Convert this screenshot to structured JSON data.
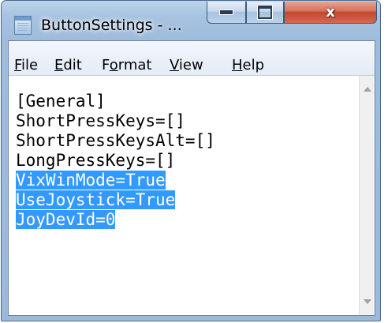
{
  "window": {
    "title": "ButtonSettings - ...",
    "close_glyph": "x",
    "icon": "notepad-icon"
  },
  "menubar": {
    "items": [
      {
        "underline": "F",
        "rest": "ile"
      },
      {
        "underline": "E",
        "rest": "dit"
      },
      {
        "pre": "F",
        "underline": "o",
        "rest": "rmat"
      },
      {
        "underline": "V",
        "rest": "iew"
      },
      {
        "underline": "H",
        "rest": "elp"
      }
    ]
  },
  "editor": {
    "lines": [
      {
        "text": "[General]",
        "selected": false
      },
      {
        "text": "ShortPressKeys=[]",
        "selected": false
      },
      {
        "text": "ShortPressKeysAlt=[]",
        "selected": false
      },
      {
        "text": "LongPressKeys=[]",
        "selected": false
      },
      {
        "text": "VixWinMode=True",
        "selected": true
      },
      {
        "text": "UseJoystick=True",
        "selected": true
      },
      {
        "text": "JoyDevId=0",
        "selected": true
      }
    ],
    "selection_color": "#3399ff"
  }
}
